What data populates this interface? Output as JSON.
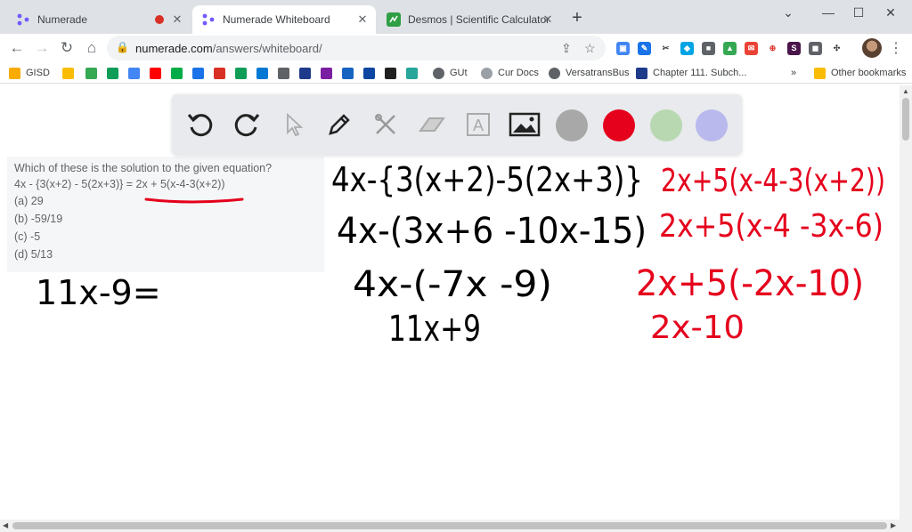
{
  "browser": {
    "tabs": [
      {
        "title": "Numerade",
        "active": false
      },
      {
        "title": "Numerade Whiteboard",
        "active": true
      },
      {
        "title": "Desmos | Scientific Calculator",
        "active": false
      }
    ],
    "url_host": "numerade.com",
    "url_path": "/answers/whiteboard/",
    "bookmarks": [
      "GISD",
      "GUt",
      "Cur Docs",
      "VersatransBus",
      "Chapter 111. Subch...",
      "»",
      "Other bookmarks"
    ]
  },
  "question": {
    "prompt": "Which of these is the solution to the given equation?",
    "equation_left": "4x - {3(x+2) - 5(2x+3)} = ",
    "equation_right": "2x + 5(x-4-3(x+2))",
    "options": [
      "(a) 29",
      "(b) -59/19",
      "(c) -5",
      "(d) 5/13"
    ]
  },
  "whiteboard": {
    "colors": {
      "gray": "#a8a8a8",
      "red": "#e5001c",
      "green": "#b7d8b0",
      "lavender": "#b9b9ee"
    },
    "black_work": [
      "4x-{3(x+2)-5(2x+3)}",
      "4x-(3x+6 -10x-15)",
      "4x-(-7x -9)",
      "11x+9"
    ],
    "red_work": [
      "2x+5(x-4-3(x+2))",
      "2x+5(x-4 -3x-6)",
      "2x+5(-2x-10)",
      "2x-10"
    ],
    "left_note": "11x-9="
  }
}
